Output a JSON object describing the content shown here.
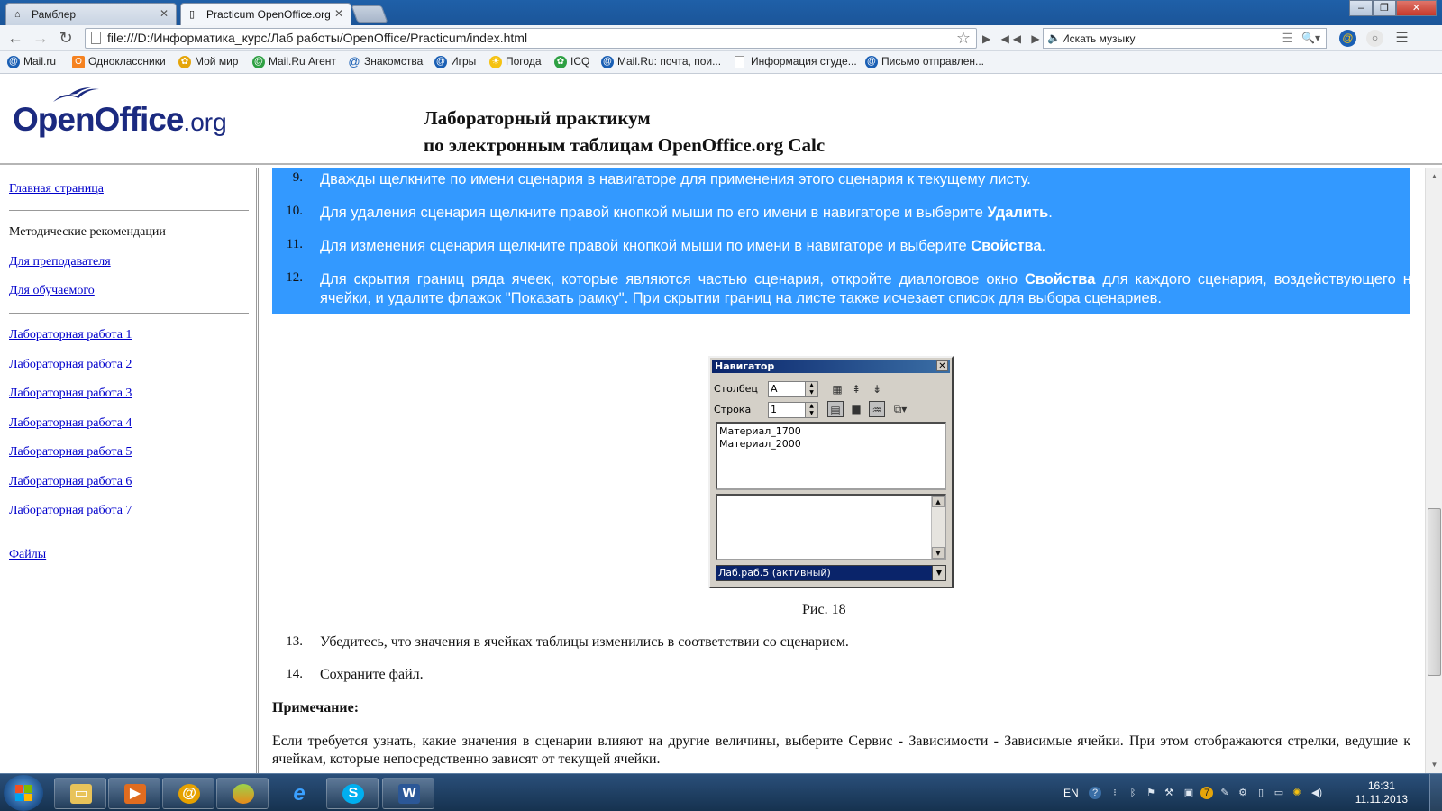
{
  "browser": {
    "tabs": [
      {
        "label": "Рамблер",
        "icon": "home-icon"
      },
      {
        "label": "Practicum OpenOffice.org",
        "icon": "page-icon"
      }
    ],
    "url": "file:///D:/Информатика_курс/Лаб работы/OpenOffice/Practicum/index.html",
    "music_search_placeholder": "Искать музыку",
    "bookmarks": [
      {
        "label": "Mail.ru",
        "color": "#1a5fb4"
      },
      {
        "label": "Одноклассники",
        "color": "#f58220"
      },
      {
        "label": "Мой мир",
        "color": "#e5a50a"
      },
      {
        "label": "Mail.Ru Агент",
        "color": "#2ea043"
      },
      {
        "label": "Знакомства",
        "color": "#1a5fb4"
      },
      {
        "label": "Игры",
        "color": "#1a5fb4"
      },
      {
        "label": "Погода",
        "color": "#f5c211"
      },
      {
        "label": "ICQ",
        "color": "#2ea043"
      },
      {
        "label": "Mail.Ru: почта, пои...",
        "color": "#1a5fb4"
      },
      {
        "label": "Информация студе...",
        "color": "#9a9a9a"
      },
      {
        "label": "Письмо отправлен...",
        "color": "#1a5fb4"
      }
    ]
  },
  "header": {
    "logo_main": "OpenOffice",
    "logo_suffix": ".org",
    "title_line1": "Лабораторный практикум",
    "title_line2": "по электронным таблицам OpenOffice.org Calc"
  },
  "sidebar": {
    "home": "Главная страница",
    "methodical": "Методические рекомендации",
    "for_teacher": "Для преподавателя",
    "for_student": "Для обучаемого",
    "labs": [
      "Лабораторная работа 1",
      "Лабораторная работа 2",
      "Лабораторная работа 3",
      "Лабораторная работа 4",
      "Лабораторная работа 5",
      "Лабораторная работа 6",
      "Лабораторная работа 7"
    ],
    "files": "Файлы"
  },
  "content": {
    "items_selected": [
      {
        "num": "9.",
        "text": "Дважды щелкните по имени сценария в навигаторе для применения этого сценария к текущему листу."
      },
      {
        "num": "10.",
        "pre": "Для удаления сценария щелкните правой кнопкой мыши по его имени в навигаторе и выберите ",
        "bold": "Удалить",
        "post": "."
      },
      {
        "num": "11.",
        "pre": "Для изменения сценария щелкните правой кнопкой мыши по имени в навигаторе и выберите ",
        "bold": "Свойства",
        "post": "."
      },
      {
        "num": "12.",
        "pre": "Для скрытия границ ряда ячеек, которые являются частью сценария, откройте диалоговое окно ",
        "bold": "Свойства",
        "post": " для каждого сценария, воздействующего на ячейки, и удалите флажок \"Показать рамку\". При скрытии границ на листе также исчезает список для выбора сценариев."
      }
    ],
    "navigator": {
      "title": "Навигатор",
      "column_label": "Столбец",
      "column_value": "A",
      "row_label": "Строка",
      "row_value": "1",
      "scenarios": [
        "Материал_1700",
        "Материал_2000"
      ],
      "document": "Лаб.раб.5 (активный)"
    },
    "caption": "Рис. 18",
    "items_after": [
      {
        "num": "13.",
        "text": "Убедитесь, что значения в ячейках таблицы изменились в соответствии со сценарием."
      },
      {
        "num": "14.",
        "text": "Сохраните файл."
      }
    ],
    "note_heading": "Примечание:",
    "note_text": "Если требуется узнать, какие значения в сценарии влияют на другие величины, выберите Сервис - Зависимости - Зависимые ячейки. При этом отображаются стрелки, ведущие к ячейкам, которые непосредственно зависят от текущей ячейки."
  },
  "taskbar": {
    "language": "EN",
    "time": "16:31",
    "date": "11.11.2013"
  },
  "colors": {
    "selection": "#3399ff",
    "link": "#0000cc",
    "logo": "#1b2a80"
  }
}
